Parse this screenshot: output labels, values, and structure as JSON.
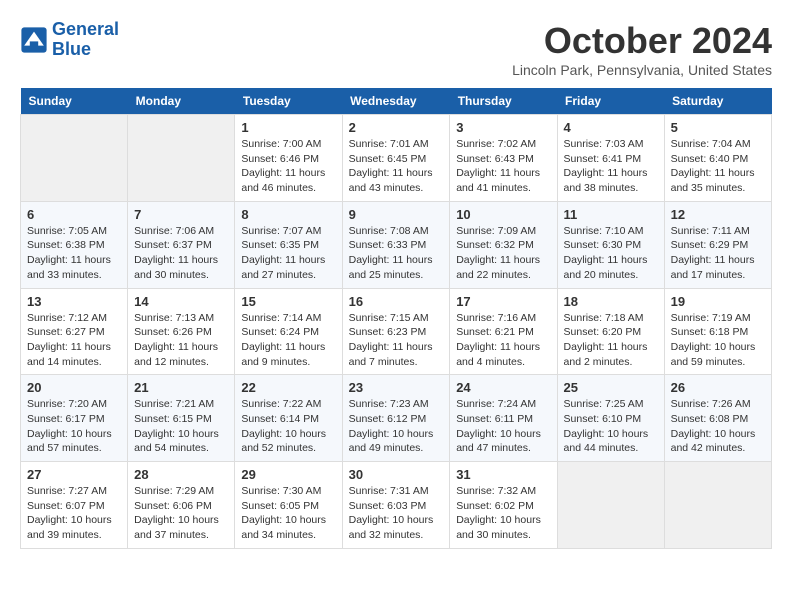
{
  "logo": {
    "line1": "General",
    "line2": "Blue"
  },
  "title": "October 2024",
  "location": "Lincoln Park, Pennsylvania, United States",
  "weekdays": [
    "Sunday",
    "Monday",
    "Tuesday",
    "Wednesday",
    "Thursday",
    "Friday",
    "Saturday"
  ],
  "weeks": [
    [
      {
        "day": "",
        "info": ""
      },
      {
        "day": "",
        "info": ""
      },
      {
        "day": "1",
        "info": "Sunrise: 7:00 AM\nSunset: 6:46 PM\nDaylight: 11 hours and 46 minutes."
      },
      {
        "day": "2",
        "info": "Sunrise: 7:01 AM\nSunset: 6:45 PM\nDaylight: 11 hours and 43 minutes."
      },
      {
        "day": "3",
        "info": "Sunrise: 7:02 AM\nSunset: 6:43 PM\nDaylight: 11 hours and 41 minutes."
      },
      {
        "day": "4",
        "info": "Sunrise: 7:03 AM\nSunset: 6:41 PM\nDaylight: 11 hours and 38 minutes."
      },
      {
        "day": "5",
        "info": "Sunrise: 7:04 AM\nSunset: 6:40 PM\nDaylight: 11 hours and 35 minutes."
      }
    ],
    [
      {
        "day": "6",
        "info": "Sunrise: 7:05 AM\nSunset: 6:38 PM\nDaylight: 11 hours and 33 minutes."
      },
      {
        "day": "7",
        "info": "Sunrise: 7:06 AM\nSunset: 6:37 PM\nDaylight: 11 hours and 30 minutes."
      },
      {
        "day": "8",
        "info": "Sunrise: 7:07 AM\nSunset: 6:35 PM\nDaylight: 11 hours and 27 minutes."
      },
      {
        "day": "9",
        "info": "Sunrise: 7:08 AM\nSunset: 6:33 PM\nDaylight: 11 hours and 25 minutes."
      },
      {
        "day": "10",
        "info": "Sunrise: 7:09 AM\nSunset: 6:32 PM\nDaylight: 11 hours and 22 minutes."
      },
      {
        "day": "11",
        "info": "Sunrise: 7:10 AM\nSunset: 6:30 PM\nDaylight: 11 hours and 20 minutes."
      },
      {
        "day": "12",
        "info": "Sunrise: 7:11 AM\nSunset: 6:29 PM\nDaylight: 11 hours and 17 minutes."
      }
    ],
    [
      {
        "day": "13",
        "info": "Sunrise: 7:12 AM\nSunset: 6:27 PM\nDaylight: 11 hours and 14 minutes."
      },
      {
        "day": "14",
        "info": "Sunrise: 7:13 AM\nSunset: 6:26 PM\nDaylight: 11 hours and 12 minutes."
      },
      {
        "day": "15",
        "info": "Sunrise: 7:14 AM\nSunset: 6:24 PM\nDaylight: 11 hours and 9 minutes."
      },
      {
        "day": "16",
        "info": "Sunrise: 7:15 AM\nSunset: 6:23 PM\nDaylight: 11 hours and 7 minutes."
      },
      {
        "day": "17",
        "info": "Sunrise: 7:16 AM\nSunset: 6:21 PM\nDaylight: 11 hours and 4 minutes."
      },
      {
        "day": "18",
        "info": "Sunrise: 7:18 AM\nSunset: 6:20 PM\nDaylight: 11 hours and 2 minutes."
      },
      {
        "day": "19",
        "info": "Sunrise: 7:19 AM\nSunset: 6:18 PM\nDaylight: 10 hours and 59 minutes."
      }
    ],
    [
      {
        "day": "20",
        "info": "Sunrise: 7:20 AM\nSunset: 6:17 PM\nDaylight: 10 hours and 57 minutes."
      },
      {
        "day": "21",
        "info": "Sunrise: 7:21 AM\nSunset: 6:15 PM\nDaylight: 10 hours and 54 minutes."
      },
      {
        "day": "22",
        "info": "Sunrise: 7:22 AM\nSunset: 6:14 PM\nDaylight: 10 hours and 52 minutes."
      },
      {
        "day": "23",
        "info": "Sunrise: 7:23 AM\nSunset: 6:12 PM\nDaylight: 10 hours and 49 minutes."
      },
      {
        "day": "24",
        "info": "Sunrise: 7:24 AM\nSunset: 6:11 PM\nDaylight: 10 hours and 47 minutes."
      },
      {
        "day": "25",
        "info": "Sunrise: 7:25 AM\nSunset: 6:10 PM\nDaylight: 10 hours and 44 minutes."
      },
      {
        "day": "26",
        "info": "Sunrise: 7:26 AM\nSunset: 6:08 PM\nDaylight: 10 hours and 42 minutes."
      }
    ],
    [
      {
        "day": "27",
        "info": "Sunrise: 7:27 AM\nSunset: 6:07 PM\nDaylight: 10 hours and 39 minutes."
      },
      {
        "day": "28",
        "info": "Sunrise: 7:29 AM\nSunset: 6:06 PM\nDaylight: 10 hours and 37 minutes."
      },
      {
        "day": "29",
        "info": "Sunrise: 7:30 AM\nSunset: 6:05 PM\nDaylight: 10 hours and 34 minutes."
      },
      {
        "day": "30",
        "info": "Sunrise: 7:31 AM\nSunset: 6:03 PM\nDaylight: 10 hours and 32 minutes."
      },
      {
        "day": "31",
        "info": "Sunrise: 7:32 AM\nSunset: 6:02 PM\nDaylight: 10 hours and 30 minutes."
      },
      {
        "day": "",
        "info": ""
      },
      {
        "day": "",
        "info": ""
      }
    ]
  ]
}
